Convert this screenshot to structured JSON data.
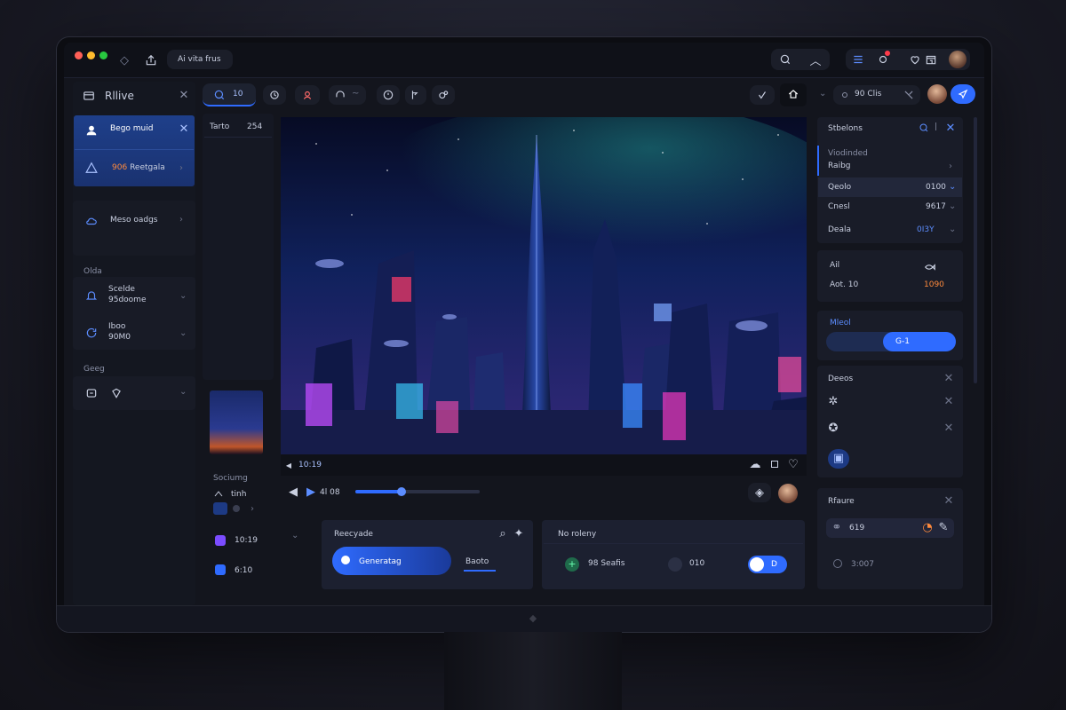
{
  "titlebar": {
    "app_title": "Ai vita frus",
    "window_dots": [
      "#ff5f57",
      "#febc2e",
      "#28c840"
    ]
  },
  "left_sidebar": {
    "header_title": "Rllive",
    "items": [
      {
        "label": "Bego muid",
        "active": true,
        "icon": "user-icon"
      },
      {
        "label_orange": "906",
        "label": "Reetgala",
        "icon": "alert-icon"
      },
      {
        "label": "Meso oadgs",
        "icon": "cloud-icon"
      }
    ],
    "section1_title": "Olda",
    "section1_items": [
      {
        "line1": "Scelde",
        "line2": "95doome",
        "icon": "bell-icon"
      },
      {
        "line1": "Iboo",
        "line2": "90M0",
        "icon": "refresh-icon"
      }
    ],
    "section2_title": "Geeg"
  },
  "toolbar": {
    "search_count": "10",
    "right_label": "90 Clis"
  },
  "col2": {
    "label": "Tarto",
    "value": "254",
    "section_title": "Sociumg",
    "row1_label": "tinh",
    "badge1": "10:19",
    "badge2": "6:10"
  },
  "video": {
    "timecode": "10:19"
  },
  "player": {
    "progress": 0.37,
    "label": "4l 08"
  },
  "bottom_left_card": {
    "title": "Reecyade",
    "button_label": "Generatag",
    "tab_label": "Baoto"
  },
  "bottom_right_card": {
    "title": "No roleny",
    "item1": "98 Seafis",
    "item2": "010",
    "toggle_label": "D"
  },
  "right_panel": {
    "header": "Stbelons",
    "items": [
      {
        "label": "Viodinded",
        "sub": "Raibg"
      },
      {
        "label": "Qeolo",
        "value": "0100"
      },
      {
        "label": "Cnesl",
        "value": "9617"
      },
      {
        "label": "Deala",
        "value": "0I3Y"
      }
    ],
    "stats": {
      "left_top": "Ail",
      "left_label": "Aot. 10",
      "right_value": "1090"
    },
    "model_title": "Mleol",
    "model_button": "G-1",
    "devices_title": "Deeos",
    "history_title": "Rfaure",
    "history_item1": "619",
    "history_item2": "3:007"
  }
}
